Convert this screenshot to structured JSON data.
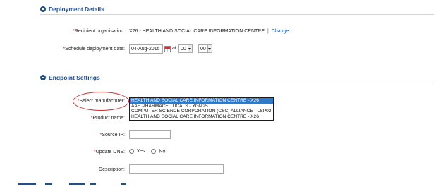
{
  "deployment": {
    "title": "Deployment Details",
    "recipient_label": "Recipient organisation:",
    "recipient_value": "X26 - HEALTH AND SOCIAL CARE INFORMATION CENTRE",
    "separator": "|",
    "change_link": "Change",
    "schedule_label": "Schedule deployment date:",
    "date_value": "04-Aug-2015",
    "at_label": "at",
    "hour": "00",
    "time_colon": ":",
    "minute": "00"
  },
  "endpoint": {
    "title": "Endpoint Settings",
    "manufacturer_label": "Select manufacturer:",
    "manufacturer_options": [
      "HEALTH AND SOCIAL CARE INFORMATION CENTRE - X26",
      "AAH PHARMACEUTICALS - YGM25",
      "COMPUTER SCIENCE CORPORATION (CSC) ALLIANCE - LSP02",
      "HEALTH AND SOCIAL CARE INFORMATION CENTRE - X26"
    ],
    "product_label": "Product name:",
    "source_ip_label": "Source IP:",
    "update_dns_label": "Update DNS:",
    "dns_yes": "Yes",
    "dns_no": "No",
    "description_label": "Description:"
  },
  "required_marker": "*",
  "colors": {
    "section_title": "#1d4f91",
    "required": "#c0282f",
    "link": "#2a5db0",
    "highlight": "#3178c6",
    "annotation": "#d42a2a"
  }
}
